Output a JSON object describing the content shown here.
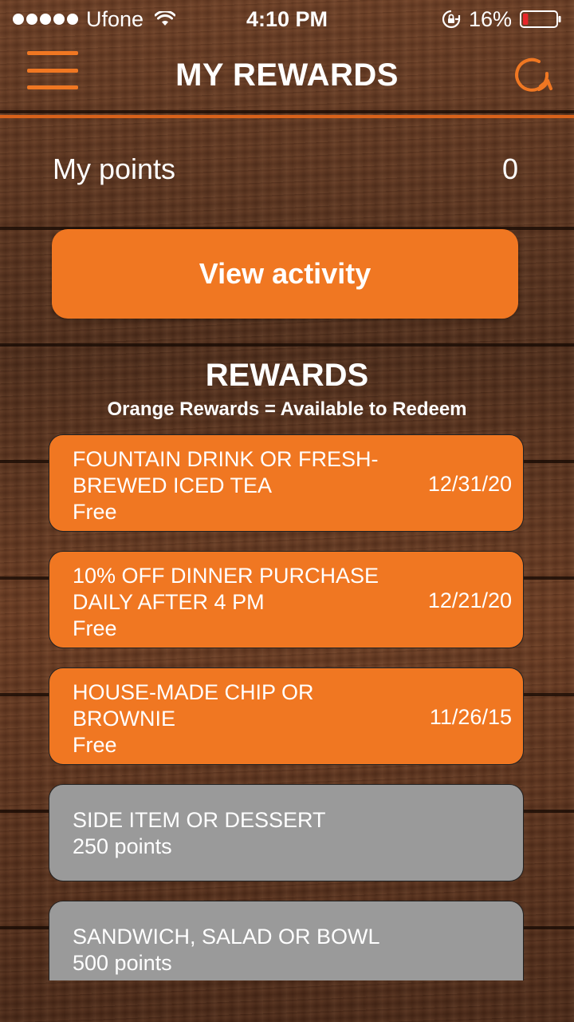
{
  "status_bar": {
    "carrier": "Ufone",
    "time": "4:10 PM",
    "battery_percent": "16%",
    "battery_level": 0.16,
    "icons": [
      "signal-icon",
      "wifi-icon",
      "orientation-lock-icon",
      "battery-icon"
    ]
  },
  "header": {
    "title": "MY REWARDS",
    "menu_icon": "hamburger-menu-icon",
    "refresh_icon": "refresh-icon"
  },
  "points": {
    "label": "My points",
    "value": "0"
  },
  "view_activity_label": "View activity",
  "rewards_section": {
    "title": "REWARDS",
    "subtitle": "Orange Rewards = Available to Redeem"
  },
  "rewards": [
    {
      "name": "FOUNTAIN DRINK OR FRESH-BREWED ICED TEA",
      "cost": "Free",
      "date": "12/31/20",
      "available": true
    },
    {
      "name": "10% OFF DINNER PURCHASE DAILY AFTER 4 PM",
      "cost": "Free",
      "date": "12/21/20",
      "available": true
    },
    {
      "name": "HOUSE-MADE CHIP OR BROWNIE",
      "cost": "Free",
      "date": "11/26/15",
      "available": true
    },
    {
      "name": "SIDE ITEM OR DESSERT",
      "cost": "250 points",
      "date": "",
      "available": false
    },
    {
      "name": "SANDWICH, SALAD OR BOWL",
      "cost": "500 points",
      "date": "",
      "available": false
    }
  ],
  "colors": {
    "accent": "#f07722",
    "locked": "#9a9a9a",
    "battery_low": "#e8262a"
  }
}
